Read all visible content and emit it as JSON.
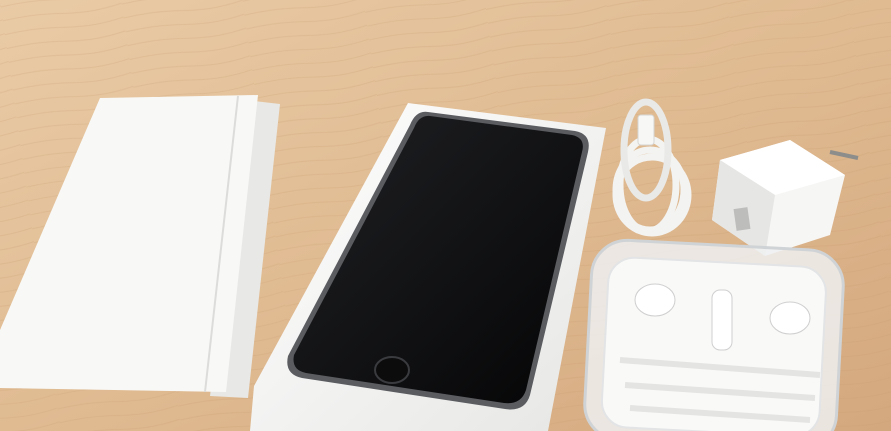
{
  "scene": {
    "description_label": "",
    "colors": {
      "table": "#e2bf98",
      "table_dark": "#cfa37a",
      "paper": "#f7f7f5",
      "phone": "#121214",
      "phone_frame": "#5a5c60",
      "accessory": "#f4f4f2"
    }
  }
}
